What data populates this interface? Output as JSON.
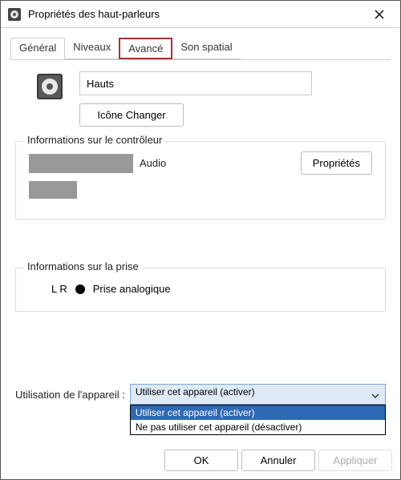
{
  "window": {
    "title": "Propriétés des haut-parleurs"
  },
  "tabs": {
    "general": "Général",
    "levels": "Niveaux",
    "advanced": "Avancé",
    "spatial": "Son spatial"
  },
  "device": {
    "name_value": "Hauts",
    "change_icon_label": "Icône Changer"
  },
  "controller": {
    "legend": "Informations sur le contrôleur",
    "audio_suffix": "Audio",
    "properties_label": "Propriétés"
  },
  "jack": {
    "legend": "Informations sur la prise",
    "lr": "L R",
    "analog": "Prise analogique"
  },
  "usage": {
    "label": "Utilisation de l'appareil :",
    "selected": "Utiliser cet appareil (activer)",
    "options": {
      "enable": "Utiliser cet appareil (activer)",
      "disable": "Ne pas utiliser cet appareil (désactiver)"
    }
  },
  "actions": {
    "ok": "OK",
    "cancel": "Annuler",
    "apply": "Appliquer"
  }
}
